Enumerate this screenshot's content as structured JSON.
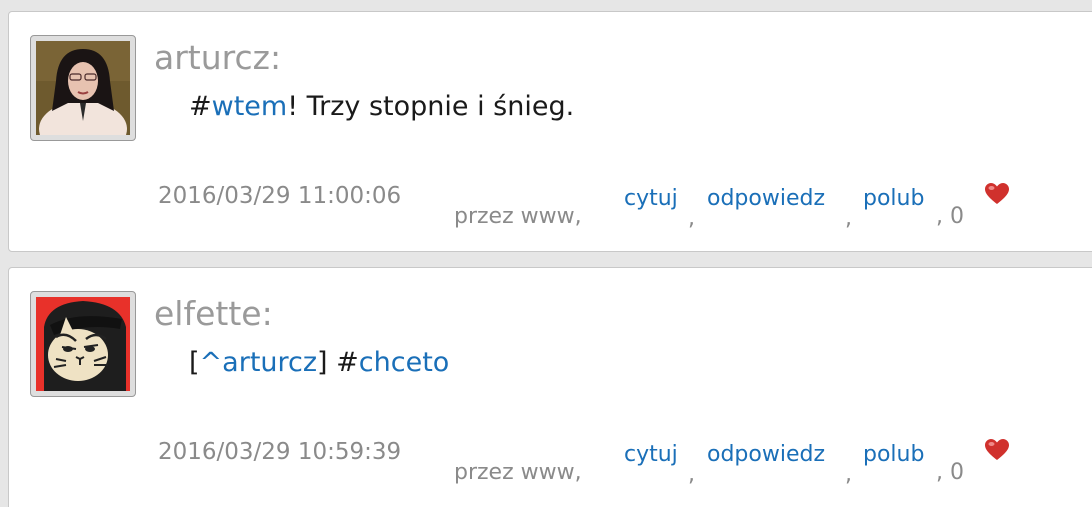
{
  "posts": [
    {
      "author": "arturcz",
      "colon": ":",
      "message": {
        "prefix": "#",
        "tag": "wtem",
        "rest": "! Trzy stopnie i śnieg."
      },
      "date": "2016/03/29 11:00:06",
      "via": "przez www,",
      "actions": {
        "quote": "cytuj",
        "reply": "odpowiedz",
        "like": "polub"
      },
      "separator": ",",
      "likes_prefix": ", 0",
      "avatar_icon": "woman-portrait-avatar"
    },
    {
      "author": "elfette",
      "colon": ":",
      "message": {
        "open_bracket": "[",
        "mention": "^arturcz",
        "close_bracket": "] #",
        "tag": "chceto"
      },
      "date": "2016/03/29 10:59:39",
      "via": "przez www,",
      "actions": {
        "quote": "cytuj",
        "reply": "odpowiedz",
        "like": "polub"
      },
      "separator": ",",
      "likes_prefix": ", 0",
      "avatar_icon": "cat-portrait-avatar"
    }
  ],
  "colors": {
    "link": "#1a6fb8",
    "muted": "#8a8a8a",
    "heart": "#d0312d"
  }
}
